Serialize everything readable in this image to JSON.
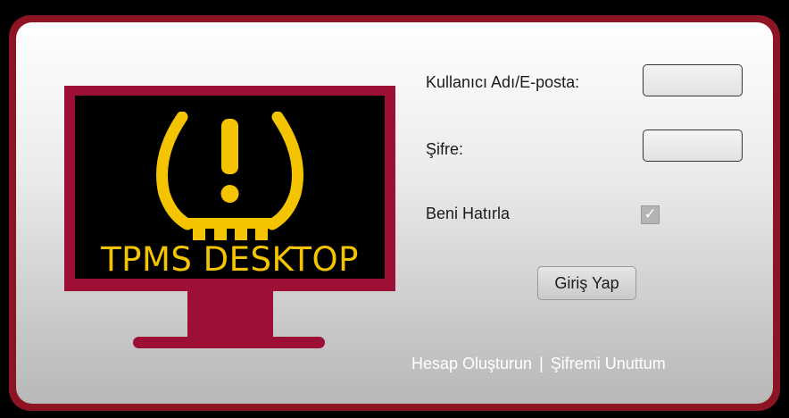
{
  "logo": {
    "text": "TPMS DESKTOP",
    "colors": {
      "monitor_frame": "#9b1034",
      "screen": "#000000",
      "icon_and_text": "#f5c400"
    },
    "icon": "tire-pressure-warning-icon"
  },
  "form": {
    "username_label": "Kullanıcı Adı/E-posta:",
    "username_value": "",
    "password_label": "Şifre:",
    "password_value": "",
    "remember_label": "Beni Hatırla",
    "remember_checked": true,
    "remember_check_glyph": "✓",
    "login_button": "Giriş Yap"
  },
  "footer": {
    "create_account": "Hesap Oluşturun",
    "separator": "|",
    "forgot_password": "Şifremi Unuttum"
  },
  "colors": {
    "window_border": "#8c1423",
    "link_text": "#ffffff"
  }
}
